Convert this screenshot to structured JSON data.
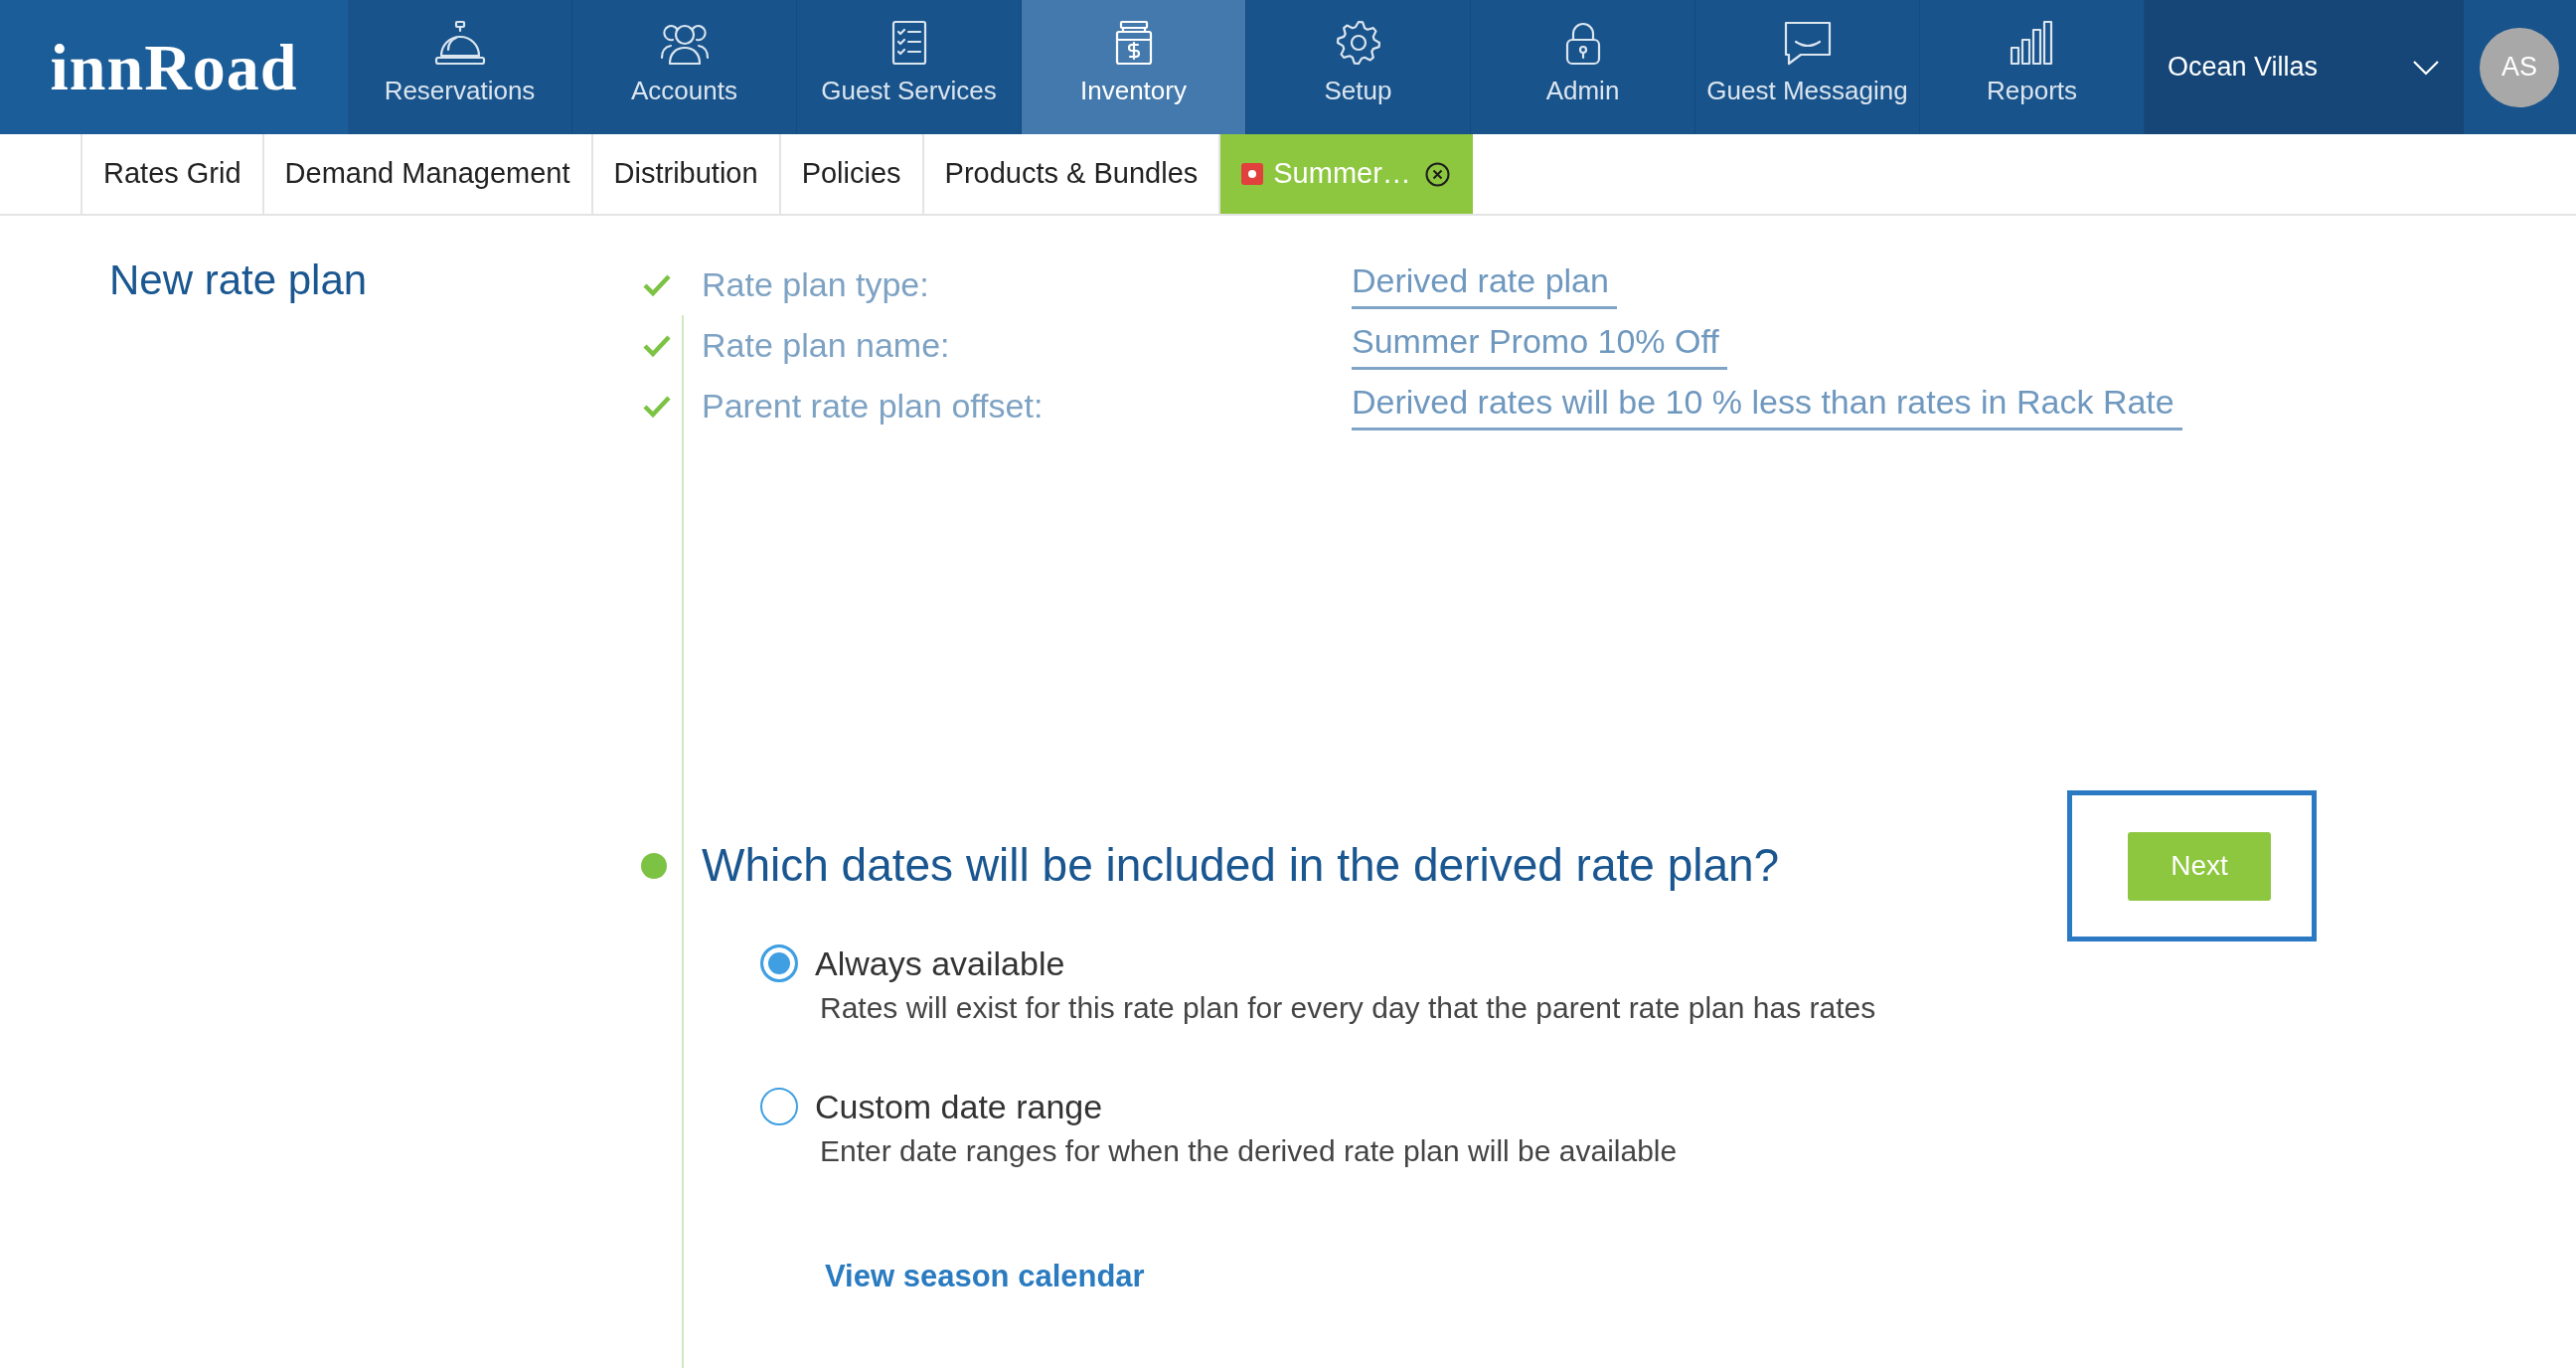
{
  "logo": {
    "text": "innRoad"
  },
  "main_nav": [
    {
      "label": "Reservations",
      "selected": false
    },
    {
      "label": "Accounts",
      "selected": false
    },
    {
      "label": "Guest Services",
      "selected": false
    },
    {
      "label": "Inventory",
      "selected": true
    },
    {
      "label": "Setup",
      "selected": false
    },
    {
      "label": "Admin",
      "selected": false
    },
    {
      "label": "Guest Messaging",
      "selected": false
    },
    {
      "label": "Reports",
      "selected": false
    }
  ],
  "property_selector": {
    "label": "Ocean Villas"
  },
  "user_avatar": {
    "initials": "AS"
  },
  "sub_nav": [
    {
      "label": "Rates Grid",
      "kind": "section",
      "selected": false
    },
    {
      "label": "Demand Management",
      "kind": "section",
      "selected": false
    },
    {
      "label": "Distribution",
      "kind": "section",
      "selected": false
    },
    {
      "label": "Policies",
      "kind": "section",
      "selected": false
    },
    {
      "label": "Products & Bundles",
      "kind": "section",
      "selected": false
    },
    {
      "label": "Summer…",
      "kind": "open_item",
      "selected": true
    }
  ],
  "page_title": "New rate plan",
  "completed_steps": [
    {
      "label": "Rate plan type:",
      "value": "Derived rate plan",
      "completed": true
    },
    {
      "label": "Rate plan name:",
      "value": "Summer Promo 10% Off",
      "completed": true
    },
    {
      "label": "Parent rate plan offset:",
      "value": "Derived rates will be 10 % less than rates in Rack Rate",
      "completed": true
    }
  ],
  "current_step": {
    "question": "Which dates will be included in the derived rate plan?",
    "options": [
      {
        "label": "Always available",
        "description": "Rates will exist for this rate plan for every day that the parent rate plan has rates",
        "selected": true
      },
      {
        "label": "Custom date range",
        "description": "Enter date ranges for when the derived rate plan will be available",
        "selected": false
      }
    ],
    "link": "View season calendar",
    "next_button": {
      "label": "Next",
      "highlighted": true
    }
  }
}
